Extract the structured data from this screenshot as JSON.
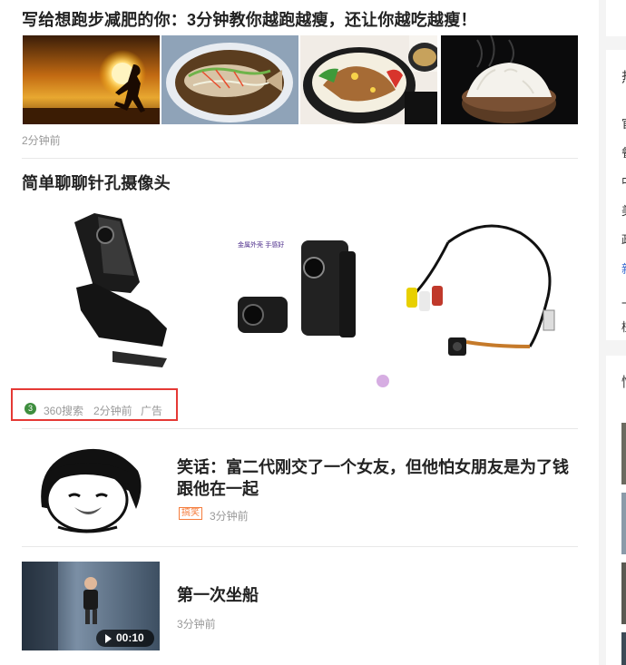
{
  "articles": [
    {
      "title": "写给想跑步减肥的你：3分钟教你越跑越瘦，还让你越吃越瘦！",
      "time": "2分钟前",
      "images": [
        "sunset-runner-image",
        "steamed-fish-image",
        "bento-box-image",
        "rice-bowl-image"
      ]
    },
    {
      "title": "简单聊聊针孔摄像头",
      "ad_index": "3",
      "source": "360搜索",
      "time": "2分钟前",
      "ad_label": "广告",
      "banner_caption": "金属外壳 手感好",
      "images": [
        "mini-camera-clip-image",
        "mini-camera-image",
        "pinhole-camera-cable-image"
      ]
    },
    {
      "title": "笑话：富二代刚交了一个女友，但他怕女朋友是为了钱跟他在一起",
      "tag": "搞笑",
      "time": "3分钟前",
      "image": "meme-face-image"
    },
    {
      "title": "第一次坐船",
      "time": "3分钟前",
      "video_duration": "00:10",
      "image": "child-video-thumbnail"
    }
  ],
  "sidebar": {
    "heading_chars": [
      "热",
      "情"
    ],
    "line_chars": [
      "官",
      "餐",
      "中",
      "美",
      "政",
      "新",
      "一",
      "植"
    ]
  },
  "colors": {
    "highlight_border": "#e53935",
    "ad_badge": "#3e8e3e",
    "tag": "#f57c3c",
    "link": "#3366cc"
  }
}
